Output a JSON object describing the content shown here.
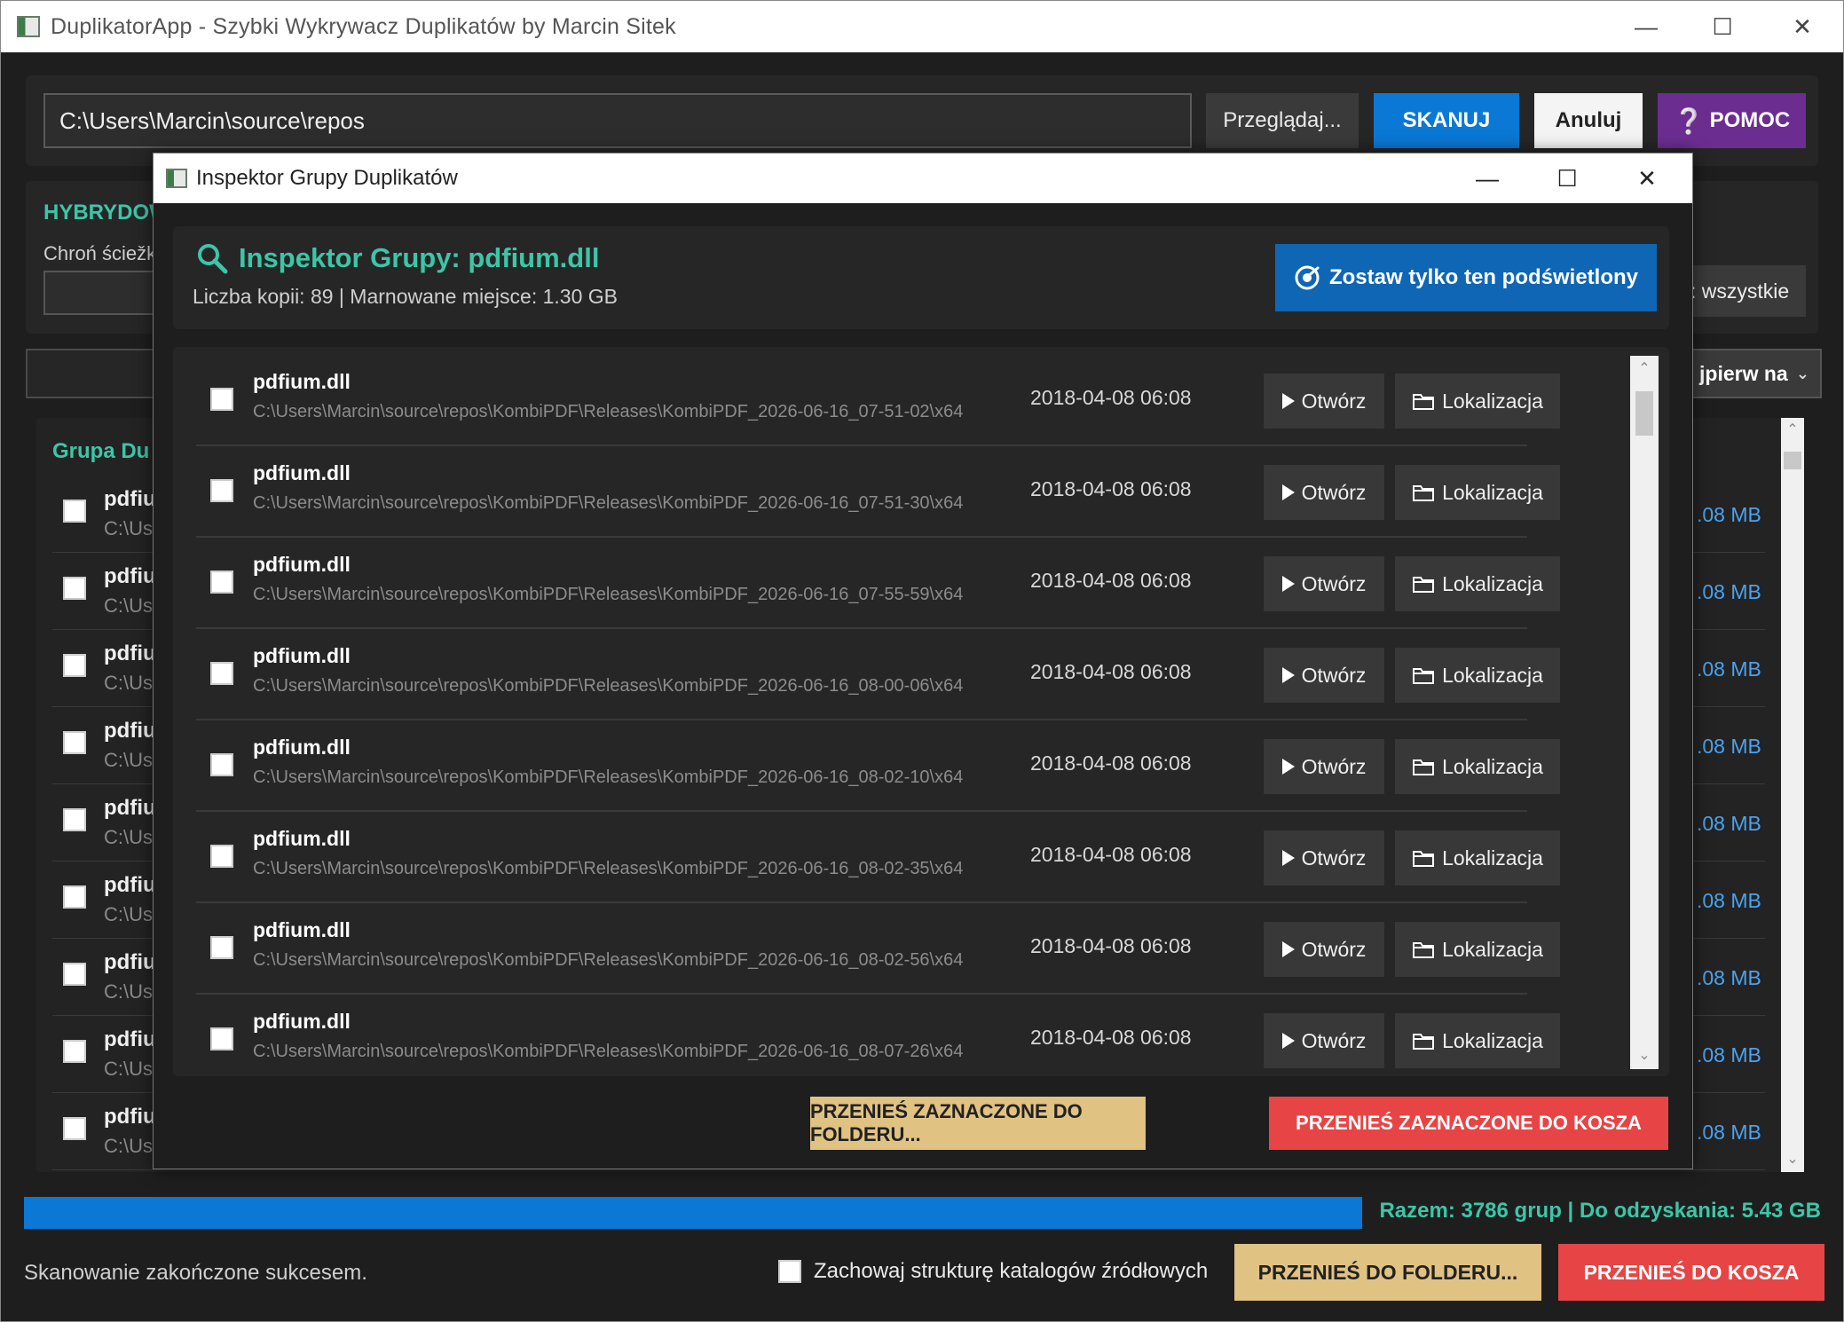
{
  "main": {
    "title": "DuplikatorApp - Szybki Wykrywacz Duplikatów by Marcin Sitek",
    "path": "C:\\Users\\Marcin\\source\\repos",
    "browse_label": "Przeglądaj...",
    "scan_label": "SKANUJ",
    "cancel_label": "Anuluj",
    "help_label": "POMOC",
    "hybrid_title": "HYBRYDOW",
    "hybrid_sub": "Chroń ściežk",
    "all_label": ": wszystkie",
    "sort_label": "jpierw na",
    "group_title": "Grupa Du",
    "rows": [
      {
        "name": "pdfiu",
        "path": "C:\\Use",
        "size": ".08 MB"
      },
      {
        "name": "pdfiu",
        "path": "C:\\Use",
        "size": ".08 MB"
      },
      {
        "name": "pdfiu",
        "path": "C:\\Use",
        "size": ".08 MB"
      },
      {
        "name": "pdfiu",
        "path": "C:\\Use",
        "size": ".08 MB"
      },
      {
        "name": "pdfiu",
        "path": "C:\\Use",
        "size": ".08 MB"
      },
      {
        "name": "pdfiu",
        "path": "C:\\Use",
        "size": ".08 MB"
      },
      {
        "name": "pdfiu",
        "path": "C:\\Use",
        "size": ".08 MB"
      },
      {
        "name": "pdfiu",
        "path": "C:\\Use",
        "size": ".08 MB"
      },
      {
        "name": "pdfiu",
        "path": "C:\\Use",
        "size": ".08 MB"
      }
    ],
    "progress": 1.0,
    "summary": "Razem: 3786 grup | Do odzyskania: 5.43 GB",
    "status": "Skanowanie zakończone sukcesem.",
    "keep_structure_label": "Zachowaj strukturę katalogów źródłowych",
    "keep_structure_checked": false,
    "move_folder_label": "PRZENIEŚ DO FOLDERU...",
    "move_trash_label": "PRZENIEŚ DO KOSZA"
  },
  "dialog": {
    "title": "Inspektor Grupy Duplikatów",
    "heading": "Inspektor Grupy: pdfium.dll",
    "stats": "Liczba kopii: 89 | Marnowane miejsce: 1.30 GB",
    "keep_label": "Zostaw tylko ten podświetlony",
    "open_label": "Otwórz",
    "locate_label": "Lokalizacja",
    "move_folder_label": "PRZENIEŚ ZAZNACZONE DO FOLDERU...",
    "move_trash_label": "PRZENIEŚ ZAZNACZONE DO KOSZA",
    "files": [
      {
        "name": "pdfium.dll",
        "path": "C:\\Users\\Marcin\\source\\repos\\KombiPDF\\Releases\\KombiPDF_2026-06-16_07-51-02\\x64",
        "date": "2018-04-08 06:08"
      },
      {
        "name": "pdfium.dll",
        "path": "C:\\Users\\Marcin\\source\\repos\\KombiPDF\\Releases\\KombiPDF_2026-06-16_07-51-30\\x64",
        "date": "2018-04-08 06:08"
      },
      {
        "name": "pdfium.dll",
        "path": "C:\\Users\\Marcin\\source\\repos\\KombiPDF\\Releases\\KombiPDF_2026-06-16_07-55-59\\x64",
        "date": "2018-04-08 06:08"
      },
      {
        "name": "pdfium.dll",
        "path": "C:\\Users\\Marcin\\source\\repos\\KombiPDF\\Releases\\KombiPDF_2026-06-16_08-00-06\\x64",
        "date": "2018-04-08 06:08"
      },
      {
        "name": "pdfium.dll",
        "path": "C:\\Users\\Marcin\\source\\repos\\KombiPDF\\Releases\\KombiPDF_2026-06-16_08-02-10\\x64",
        "date": "2018-04-08 06:08"
      },
      {
        "name": "pdfium.dll",
        "path": "C:\\Users\\Marcin\\source\\repos\\KombiPDF\\Releases\\KombiPDF_2026-06-16_08-02-35\\x64",
        "date": "2018-04-08 06:08"
      },
      {
        "name": "pdfium.dll",
        "path": "C:\\Users\\Marcin\\source\\repos\\KombiPDF\\Releases\\KombiPDF_2026-06-16_08-02-56\\x64",
        "date": "2018-04-08 06:08"
      },
      {
        "name": "pdfium.dll",
        "path": "C:\\Users\\Marcin\\source\\repos\\KombiPDF\\Releases\\KombiPDF_2026-06-16_08-07-26\\x64",
        "date": "2018-04-08 06:08"
      }
    ]
  },
  "colors": {
    "accent_teal": "#3cc6a8",
    "scan_blue": "#0a78d4",
    "help_purple": "#6c2d91",
    "folder_gold": "#e0c283",
    "trash_red": "#e74545",
    "size_blue": "#4aa3f0"
  },
  "icons": {
    "search": "magnifier-icon",
    "keep": "target-check-icon",
    "open": "play-icon",
    "locate": "folder-icon",
    "help": "question-icon"
  }
}
